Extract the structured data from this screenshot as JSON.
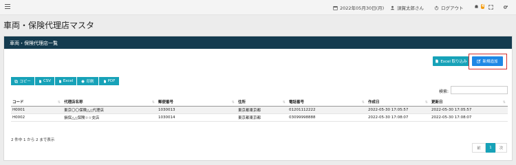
{
  "topbar": {
    "date": "2022年05月30日(月)",
    "user": "須賀太郎さん",
    "logout": "ログアウト",
    "notification_count": "4"
  },
  "page_title": "車両・保険代理店マスタ",
  "panel": {
    "title": "車両・保険代理店一覧",
    "excel_import_label": "Excel 取り込み",
    "new_label": "新規追加"
  },
  "export_buttons": [
    "コピー",
    "CSV",
    "Excel",
    "印刷",
    "PDF"
  ],
  "search": {
    "label": "検索:",
    "value": ""
  },
  "table": {
    "columns": [
      "コード",
      "代理店名称",
      "郵便番号",
      "住所",
      "電話番号",
      "作成日",
      "更新日"
    ],
    "rows": [
      [
        "H0001",
        "東京〇〇保険△△代理店",
        "1030013",
        "東京都東京都",
        "01201112222",
        "2022-05-30 17:05:57",
        "2022-05-30 17:05:57"
      ],
      [
        "H0002",
        "損保△△保険☆☆支店",
        "1030014",
        "東京都東京都",
        "03099998888",
        "2022-05-30 17:08:07",
        "2022-05-30 17:08:07"
      ]
    ]
  },
  "info": "2 件中 1 から 2 まで表示",
  "pagination": {
    "prev": "前",
    "current": "1",
    "next": "次"
  },
  "colors": {
    "header_bg": "#143b4f",
    "teal": "#17a2b8",
    "primary": "#1e88e5",
    "highlight": "#d32f2f"
  }
}
